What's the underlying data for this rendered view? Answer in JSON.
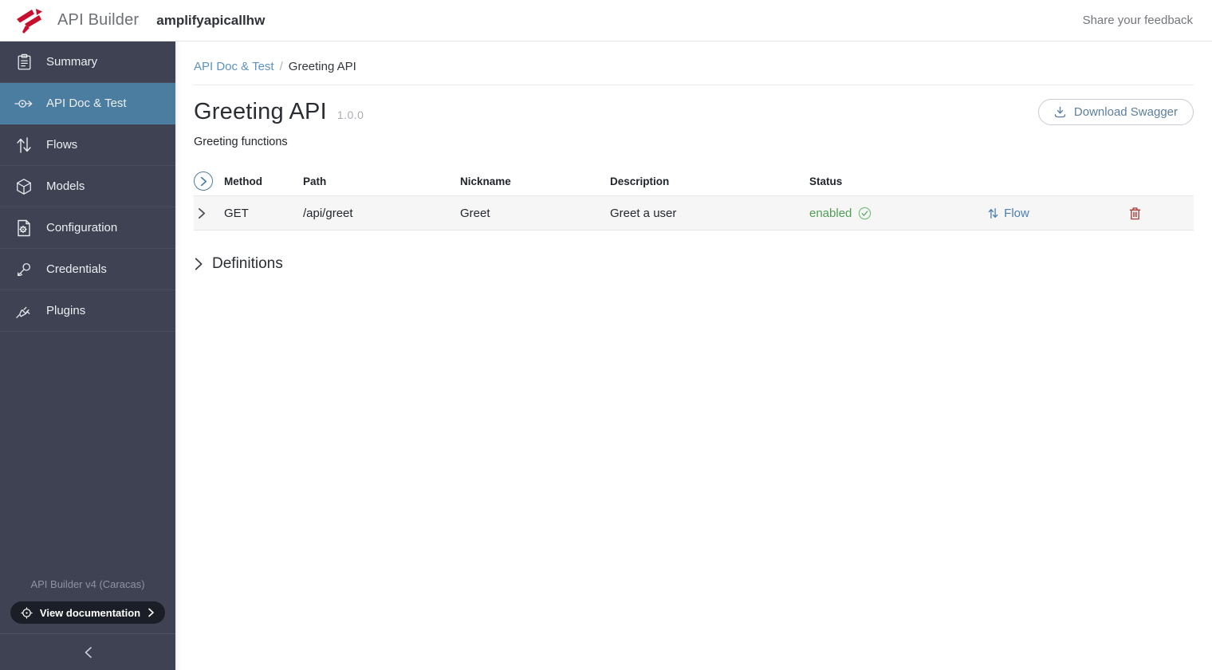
{
  "topbar": {
    "app_title": "API Builder",
    "project_name": "amplifyapicallhw",
    "feedback_label": "Share your feedback"
  },
  "sidebar": {
    "items": [
      {
        "label": "Summary",
        "icon": "clipboard-icon",
        "active": false
      },
      {
        "label": "API Doc & Test",
        "icon": "api-doc-icon",
        "active": true
      },
      {
        "label": "Flows",
        "icon": "flows-icon",
        "active": false
      },
      {
        "label": "Models",
        "icon": "cube-icon",
        "active": false
      },
      {
        "label": "Configuration",
        "icon": "config-icon",
        "active": false
      },
      {
        "label": "Credentials",
        "icon": "key-icon",
        "active": false
      },
      {
        "label": "Plugins",
        "icon": "plug-icon",
        "active": false
      }
    ],
    "version_label": "API Builder v4 (Caracas)",
    "view_documentation_label": "View documentation"
  },
  "breadcrumb": {
    "parent": "API Doc & Test",
    "separator": "/",
    "current": "Greeting API"
  },
  "page": {
    "title": "Greeting API",
    "version": "1.0.0",
    "subtitle": "Greeting functions",
    "download_button_label": "Download Swagger"
  },
  "endpoints_table": {
    "columns": [
      "Method",
      "Path",
      "Nickname",
      "Description",
      "Status"
    ],
    "rows": [
      {
        "method": "GET",
        "path": "/api/greet",
        "nickname": "Greet",
        "description": "Greet a user",
        "status": "enabled",
        "flow_label": "Flow"
      }
    ]
  },
  "definitions_section": {
    "label": "Definitions"
  },
  "colors": {
    "brand_red": "#c8102e",
    "sidebar_bg": "#3f4253",
    "sidebar_active": "#4a7da0",
    "breadcrumb_link_blue": "#5d91c2",
    "flow_link_blue": "#4a7db5",
    "enabled_green": "#4f9e53",
    "trash_red": "#a8453e",
    "button_text_blue": "#5c7f9e"
  }
}
